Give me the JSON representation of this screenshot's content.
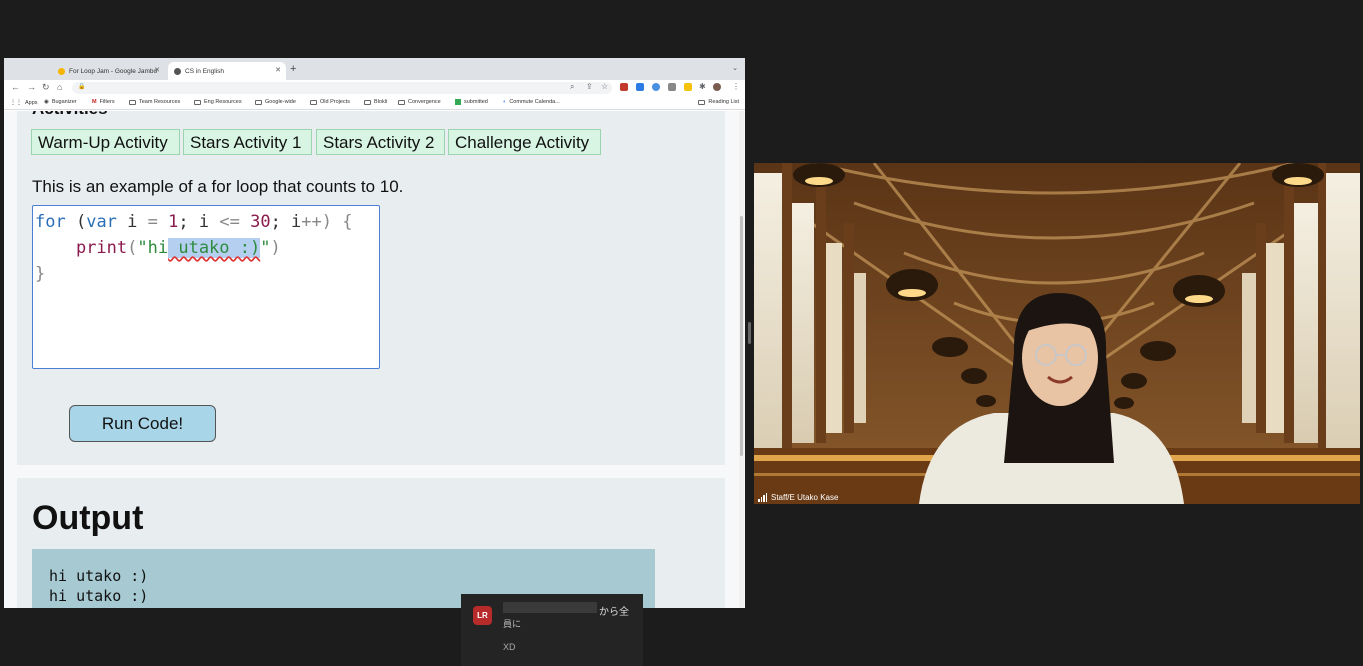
{
  "browser": {
    "tabs": [
      {
        "title": "For Loop Jam - Google Jambo",
        "favicon_color": "#f4b400"
      },
      {
        "title": "CS in English",
        "favicon_color": "#555555"
      }
    ],
    "bookmarks": [
      "Apps",
      "Buganizer",
      "Filters",
      "Team Resources",
      "Eng Resources",
      "Google-wide",
      "Old Projects",
      "Blokli",
      "Convergence",
      "submitted",
      "Commute Calenda..."
    ],
    "reading_list": "Reading List"
  },
  "page": {
    "activities_heading": "Activities",
    "activity_buttons": [
      "Warm-Up Activity",
      "Stars Activity 1",
      "Stars Activity 2",
      "Challenge Activity"
    ],
    "example_text": "This is an example of a for loop that counts to 10.",
    "code": {
      "line1": {
        "kw1": "for",
        "p1": " (",
        "kw2": "var",
        "p2": " i ",
        "op1": "=",
        "p3": " ",
        "n1": "1",
        "p4": "; i ",
        "op2": "<=",
        "p5": " ",
        "n2": "30",
        "p6": "; i",
        "op3": "++",
        "p7": ") {"
      },
      "line2": {
        "indent": "    ",
        "fn": "print",
        "p1": "(",
        "str1": "\"hi",
        "sel": " utako :)",
        "str2": "\"",
        "p2": ")"
      },
      "line3": "}"
    },
    "run_button": "Run Code!",
    "output_title": "Output",
    "output_lines": [
      "hi utako :)",
      "hi utako :)"
    ]
  },
  "video": {
    "name": "Staff/E Utako Kase"
  },
  "toast": {
    "avatar": "LR",
    "from_suffix": "から全",
    "to": "員に",
    "message": "XD"
  },
  "colors": {
    "activity_bg": "#d8f5e3",
    "run_button_bg": "#a8d6e8",
    "output_bg": "#a6c9d2",
    "editor_border": "#4a7fd4"
  }
}
